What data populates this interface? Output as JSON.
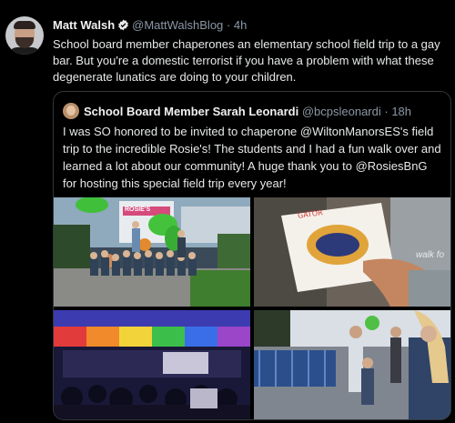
{
  "tweet": {
    "author_name": "Matt Walsh",
    "handle": "@MattWalshBlog",
    "time": "· 4h",
    "text": "School board member chaperones an elementary school field trip to a gay bar. But you're a domestic terrorist if you have a problem with what these degenerate lunatics are doing to your children."
  },
  "quoted": {
    "author_name": "School Board Member Sarah Leonardi",
    "handle": "@bcpsleonardi",
    "time": "· 18h",
    "text": "I was SO honored to be invited to chaperone @WiltonManorsES's field trip to the incredible Rosie's! The students and I had a fun walk over and learned a lot about our community! A huge thank you to @RosiesBnG for hosting this special field trip every year!"
  },
  "photos": {
    "sign_text": "ROSIE'S",
    "card_text": "GATOR",
    "shirt_text": "walk fo"
  },
  "colors": {
    "background": "#000000",
    "verified_badge": "#e7e9ea",
    "muted_text": "#8b98a5",
    "border": "#333639"
  }
}
